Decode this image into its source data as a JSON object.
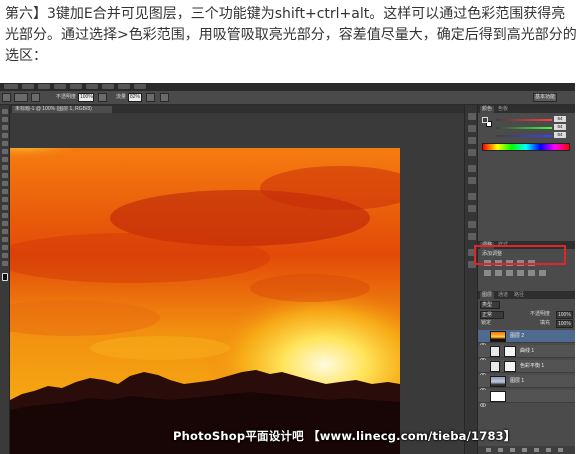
{
  "article": {
    "step_label": "第六】",
    "text": "3键加E合并可见图层，三个功能键为shift+ctrl+alt。这样可以通过色彩范围获得亮光部分。通过选择>色彩范围，用吸管吸取亮光部分，容差值尽量大，确定后得到高光部分的选区："
  },
  "photoshop": {
    "options_bar": {
      "mode_label": "不透明度",
      "opacity_value": "100%",
      "flow_label": "流量",
      "flow_value": "82%",
      "workspace_label": "基本功能"
    },
    "document_tab": "未标题-1 @ 100% (图层 1, RGB/8)",
    "panel_tabs": {
      "color": "颜色",
      "swatches": "色板",
      "adjustments": "调整",
      "styles": "样式",
      "layers": "图层",
      "channels": "通道",
      "paths": "路径"
    },
    "color_panel": {
      "r_value": "64",
      "g_value": "64",
      "b_value": "64"
    },
    "adjustments_label": "添加调整",
    "layers_panel": {
      "kind_label": "类型",
      "blend_mode": "正常",
      "opacity_label": "不透明度",
      "opacity_value": "100%",
      "lock_label": "锁定",
      "fill_label": "填充",
      "fill_value": "100%",
      "layers": [
        {
          "name": "图层 2",
          "selected": true,
          "thumb": "sunset"
        },
        {
          "name": "曲线 1",
          "selected": false,
          "thumb": "curves"
        },
        {
          "name": "色彩平衡 1",
          "selected": false,
          "thumb": "balance"
        },
        {
          "name": "图层 1",
          "selected": false,
          "thumb": "photo"
        },
        {
          "name": "",
          "selected": false,
          "thumb": "white"
        }
      ]
    },
    "watermark": "PhotoShop平面设计吧 【www.linecg.com/tieba/1783】"
  }
}
